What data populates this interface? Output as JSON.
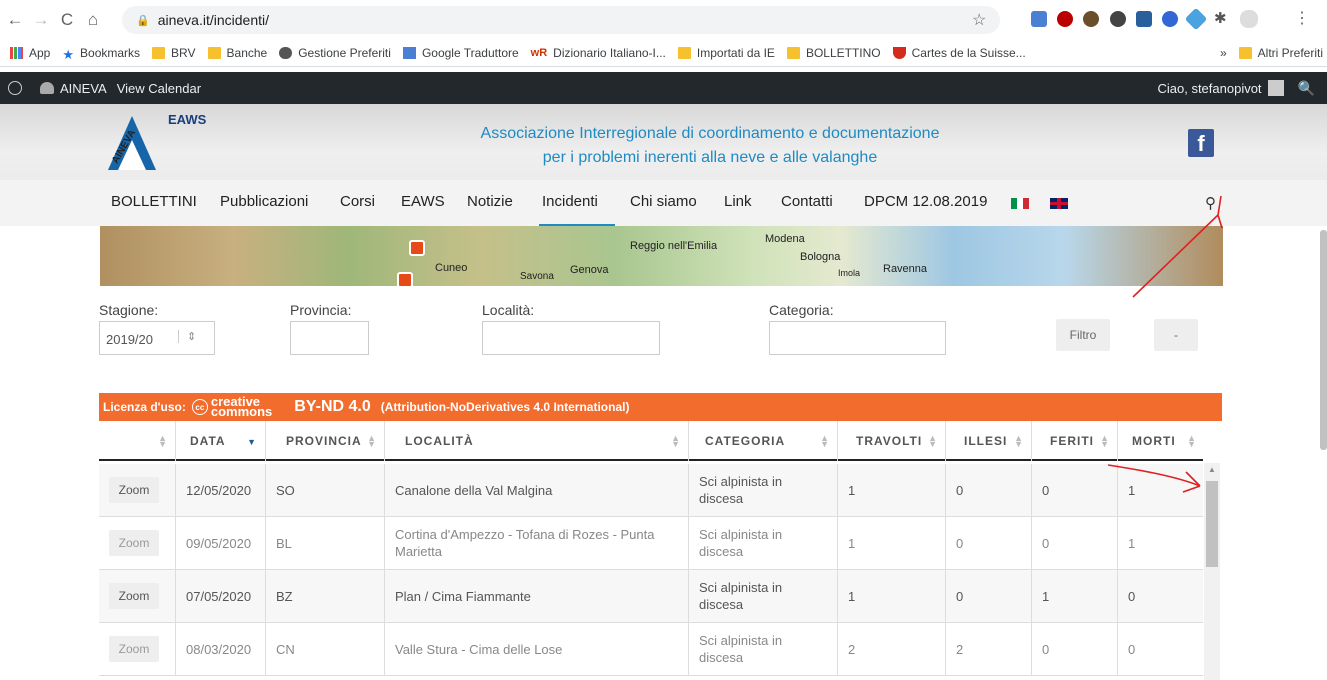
{
  "browser": {
    "url": "aineva.it/incidenti/",
    "bookmarks": [
      "App",
      "Bookmarks",
      "BRV",
      "Banche",
      "Gestione Preferiti",
      "Google Traduttore",
      "Dizionario Italiano-I...",
      "Importati da IE",
      "BOLLETTINO",
      "Cartes de la Suisse...",
      "Altri Preferiti"
    ],
    "more": "»"
  },
  "wp_admin": {
    "site_name": "AINEVA",
    "view_calendar": "View Calendar",
    "greeting": "Ciao, stefanopivot"
  },
  "header": {
    "logo_text": "EAWS",
    "tagline_1": "Associazione Interregionale di coordinamento e documentazione",
    "tagline_2": "per i problemi inerenti alla neve e alle valanghe",
    "facebook": "f"
  },
  "nav": {
    "items": [
      "BOLLETTINI",
      "Pubblicazioni",
      "Corsi",
      "EAWS",
      "Notizie",
      "Incidenti",
      "Chi siamo",
      "Link",
      "Contatti",
      "DPCM 12.08.2019"
    ],
    "active": "Incidenti"
  },
  "map": {
    "labels": [
      "Reggio nell'Emilia",
      "Modena",
      "Bologna",
      "Ravenna",
      "Imola",
      "Cuneo",
      "Savona",
      "Genova"
    ]
  },
  "filters": {
    "stagione_label": "Stagione:",
    "stagione_value": "2019/20",
    "provincia_label": "Provincia:",
    "localita_label": "Località:",
    "categoria_label": "Categoria:",
    "filtro_button": "Filtro",
    "reset_button": "-"
  },
  "license": {
    "prefix": "Licenza d'uso:",
    "cc_1": "creative",
    "cc_2": "commons",
    "type": "BY-ND 4.0",
    "desc": "(Attribution-NoDerivatives 4.0 International)"
  },
  "table": {
    "headers": [
      "",
      "DATA",
      "PROVINCIA",
      "LOCALITÀ",
      "CATEGORIA",
      "TRAVOLTI",
      "ILLESI",
      "FERITI",
      "MORTI"
    ],
    "rows": [
      {
        "zoom": "Zoom",
        "data": "12/05/2020",
        "prov": "SO",
        "loc": "Canalone della Val Malgina",
        "cat": "Sci alpinista in discesa",
        "travolti": "1",
        "illesi": "0",
        "feriti": "0",
        "morti": "1"
      },
      {
        "zoom": "Zoom",
        "data": "09/05/2020",
        "prov": "BL",
        "loc": "Cortina d'Ampezzo - Tofana di Rozes - Punta Marietta",
        "cat": "Sci alpinista in discesa",
        "travolti": "1",
        "illesi": "0",
        "feriti": "0",
        "morti": "1"
      },
      {
        "zoom": "Zoom",
        "data": "07/05/2020",
        "prov": "BZ",
        "loc": "Plan / Cima Fiammante",
        "cat": "Sci alpinista in discesa",
        "travolti": "1",
        "illesi": "0",
        "feriti": "1",
        "morti": "0"
      },
      {
        "zoom": "Zoom",
        "data": "08/03/2020",
        "prov": "CN",
        "loc": "Valle Stura - Cima delle Lose",
        "cat": "Sci alpinista in discesa",
        "travolti": "2",
        "illesi": "2",
        "feriti": "0",
        "morti": "0"
      }
    ]
  },
  "colors": {
    "accent": "#1e8bc3",
    "license_bar": "#f26c2e",
    "annotation": "#e02020"
  }
}
